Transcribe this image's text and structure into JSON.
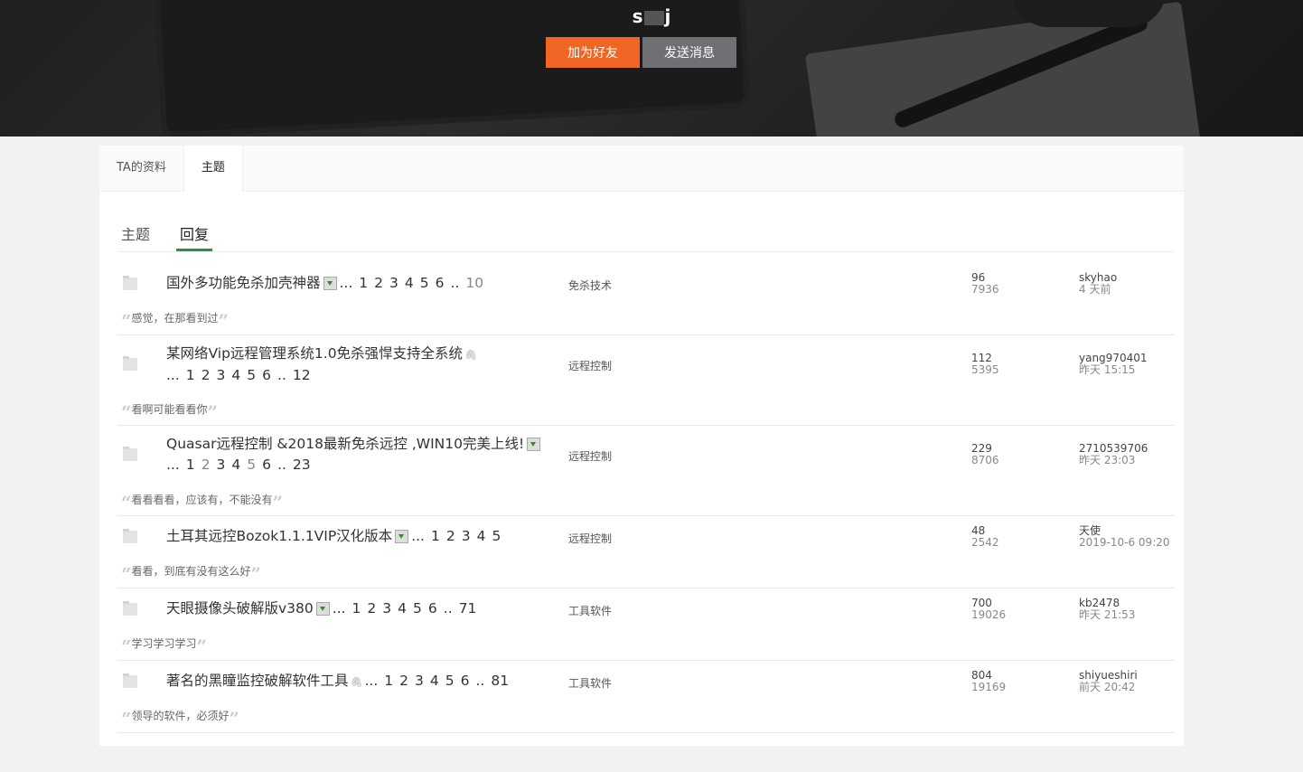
{
  "profile": {
    "name_start": "s",
    "name_end": "j",
    "add_friend": "加为好友",
    "send_message": "发送消息"
  },
  "tabs": [
    {
      "label": "TA的资料",
      "active": false
    },
    {
      "label": "主题",
      "active": true
    }
  ],
  "subtabs": [
    {
      "label": "主题",
      "active": false
    },
    {
      "label": "回复",
      "active": true
    }
  ],
  "threads": [
    {
      "title": "国外多功能免杀加壳神器",
      "icon": "image",
      "pages": [
        "...",
        "1",
        "2",
        "3",
        "4",
        "5",
        "6",
        "..",
        "10"
      ],
      "category": "免杀技术",
      "replies": "96",
      "views": "7936",
      "last_user": "skyhao",
      "last_time": "4 天前",
      "quote": "感觉，在那看到过"
    },
    {
      "title": "某网络Vip远程管理系统1.0免杀强悍支持全系统",
      "icon": "attachment",
      "pages": [
        "...",
        "1",
        "2",
        "3",
        "4",
        "5",
        "6",
        "..",
        "12"
      ],
      "category": "远程控制",
      "replies": "112",
      "views": "5395",
      "last_user": "yang970401",
      "last_time": "昨天 15:15",
      "quote": "看啊可能看看你"
    },
    {
      "title": "Quasar远程控制 &2018最新免杀远控 ,WIN10完美上线!",
      "icon": "image",
      "pages": [
        "...",
        "1",
        "2",
        "3",
        "4",
        "5",
        "6",
        "..",
        "23"
      ],
      "category": "远程控制",
      "replies": "229",
      "views": "8706",
      "last_user": "2710539706",
      "last_time": "昨天 23:03",
      "quote": "看看看看，应该有，不能没有"
    },
    {
      "title": "土耳其远控Bozok1.1.1VIP汉化版本",
      "icon": "image",
      "pages": [
        "...",
        "1",
        "2",
        "3",
        "4",
        "5"
      ],
      "category": "远程控制",
      "replies": "48",
      "views": "2542",
      "last_user": "天使",
      "last_time": "2019-10-6 09:20",
      "quote": "看看，到底有没有这么好"
    },
    {
      "title": "天眼摄像头破解版v380",
      "icon": "image",
      "pages": [
        "...",
        "1",
        "2",
        "3",
        "4",
        "5",
        "6",
        "..",
        "71"
      ],
      "category": "工具软件",
      "replies": "700",
      "views": "19026",
      "last_user": "kb2478",
      "last_time": "昨天 21:53",
      "quote": "学习学习学习"
    },
    {
      "title": "著名的黑瞳监控破解软件工具",
      "icon": "attachment",
      "pages": [
        "...",
        "1",
        "2",
        "3",
        "4",
        "5",
        "6",
        "..",
        "81"
      ],
      "category": "工具软件",
      "replies": "804",
      "views": "19169",
      "last_user": "shiyueshiri",
      "last_time": "前天 20:42",
      "quote": "领导的软件，必须好"
    }
  ],
  "quote_marks": {
    "open": "“",
    "close": "”"
  }
}
